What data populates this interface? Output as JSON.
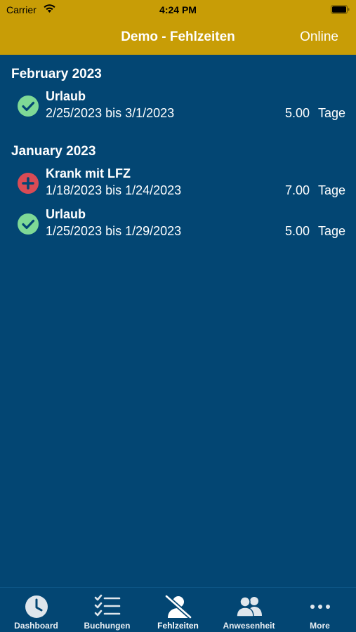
{
  "status": {
    "carrier": "Carrier",
    "time": "4:24 PM"
  },
  "nav": {
    "title": "Demo - Fehlzeiten",
    "online": "Online"
  },
  "sections": [
    {
      "title": "February 2023",
      "entries": [
        {
          "icon": "check-circle-icon",
          "type": "Urlaub",
          "range": "2/25/2023 bis 3/1/2023",
          "days": "5.00",
          "unit": "Tage"
        }
      ]
    },
    {
      "title": "January 2023",
      "entries": [
        {
          "icon": "plus-circle-icon",
          "type": "Krank mit LFZ",
          "range": "1/18/2023 bis 1/24/2023",
          "days": "7.00",
          "unit": "Tage"
        },
        {
          "icon": "check-circle-icon",
          "type": "Urlaub",
          "range": "1/25/2023 bis 1/29/2023",
          "days": "5.00",
          "unit": "Tage"
        }
      ]
    }
  ],
  "tabs": [
    {
      "label": "Dashboard",
      "icon": "clock-icon"
    },
    {
      "label": "Buchungen",
      "icon": "checklist-icon"
    },
    {
      "label": "Fehlzeiten",
      "icon": "person-off-icon"
    },
    {
      "label": "Anwesenheit",
      "icon": "people-icon"
    },
    {
      "label": "More",
      "icon": "more-icon"
    }
  ],
  "colors": {
    "header": "#C89D06",
    "background": "#034673",
    "approved": "#7ED996",
    "sick": "#D94B55"
  }
}
